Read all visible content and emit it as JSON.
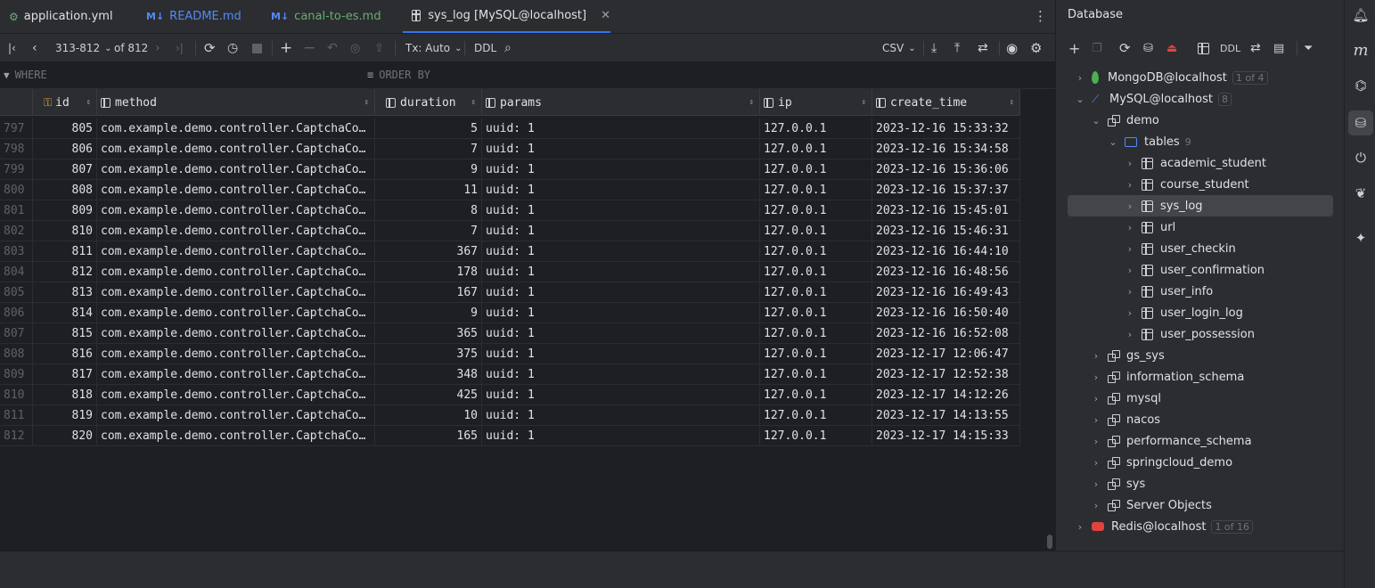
{
  "tabs": [
    {
      "label": "application.yml",
      "icon": "yaml-file-icon"
    },
    {
      "label": "README.md",
      "prefix": "M↓",
      "icon": "markdown-file-icon"
    },
    {
      "label": "canal-to-es.md",
      "prefix": "M↓",
      "icon": "markdown-file-icon"
    },
    {
      "label": "sys_log [MySQL@localhost]",
      "icon": "table-icon",
      "active": true
    }
  ],
  "toolbar": {
    "range": "313-812",
    "of_total": "of 812",
    "tx_mode": "Tx: Auto",
    "ddl": "DDL",
    "export_format": "CSV"
  },
  "filter": {
    "where": "WHERE",
    "order_by": "ORDER BY"
  },
  "table": {
    "columns": [
      "id",
      "method",
      "duration",
      "params",
      "ip",
      "create_time"
    ],
    "rows": [
      {
        "n": "797",
        "id": "805",
        "method": "com.example.demo.controller.CaptchaCo…",
        "duration": "5",
        "params": "uuid: 1",
        "ip": "127.0.0.1",
        "create_time": "2023-12-16 15:33:32"
      },
      {
        "n": "798",
        "id": "806",
        "method": "com.example.demo.controller.CaptchaCo…",
        "duration": "7",
        "params": "uuid: 1",
        "ip": "127.0.0.1",
        "create_time": "2023-12-16 15:34:58"
      },
      {
        "n": "799",
        "id": "807",
        "method": "com.example.demo.controller.CaptchaCo…",
        "duration": "9",
        "params": "uuid: 1",
        "ip": "127.0.0.1",
        "create_time": "2023-12-16 15:36:06"
      },
      {
        "n": "800",
        "id": "808",
        "method": "com.example.demo.controller.CaptchaCo…",
        "duration": "11",
        "params": "uuid: 1",
        "ip": "127.0.0.1",
        "create_time": "2023-12-16 15:37:37"
      },
      {
        "n": "801",
        "id": "809",
        "method": "com.example.demo.controller.CaptchaCo…",
        "duration": "8",
        "params": "uuid: 1",
        "ip": "127.0.0.1",
        "create_time": "2023-12-16 15:45:01"
      },
      {
        "n": "802",
        "id": "810",
        "method": "com.example.demo.controller.CaptchaCo…",
        "duration": "7",
        "params": "uuid: 1",
        "ip": "127.0.0.1",
        "create_time": "2023-12-16 15:46:31"
      },
      {
        "n": "803",
        "id": "811",
        "method": "com.example.demo.controller.CaptchaCo…",
        "duration": "367",
        "params": "uuid: 1",
        "ip": "127.0.0.1",
        "create_time": "2023-12-16 16:44:10"
      },
      {
        "n": "804",
        "id": "812",
        "method": "com.example.demo.controller.CaptchaCo…",
        "duration": "178",
        "params": "uuid: 1",
        "ip": "127.0.0.1",
        "create_time": "2023-12-16 16:48:56"
      },
      {
        "n": "805",
        "id": "813",
        "method": "com.example.demo.controller.CaptchaCo…",
        "duration": "167",
        "params": "uuid: 1",
        "ip": "127.0.0.1",
        "create_time": "2023-12-16 16:49:43"
      },
      {
        "n": "806",
        "id": "814",
        "method": "com.example.demo.controller.CaptchaCo…",
        "duration": "9",
        "params": "uuid: 1",
        "ip": "127.0.0.1",
        "create_time": "2023-12-16 16:50:40"
      },
      {
        "n": "807",
        "id": "815",
        "method": "com.example.demo.controller.CaptchaCo…",
        "duration": "365",
        "params": "uuid: 1",
        "ip": "127.0.0.1",
        "create_time": "2023-12-16 16:52:08"
      },
      {
        "n": "808",
        "id": "816",
        "method": "com.example.demo.controller.CaptchaCo…",
        "duration": "375",
        "params": "uuid: 1",
        "ip": "127.0.0.1",
        "create_time": "2023-12-17 12:06:47"
      },
      {
        "n": "809",
        "id": "817",
        "method": "com.example.demo.controller.CaptchaCo…",
        "duration": "348",
        "params": "uuid: 1",
        "ip": "127.0.0.1",
        "create_time": "2023-12-17 12:52:38"
      },
      {
        "n": "810",
        "id": "818",
        "method": "com.example.demo.controller.CaptchaCo…",
        "duration": "425",
        "params": "uuid: 1",
        "ip": "127.0.0.1",
        "create_time": "2023-12-17 14:12:26"
      },
      {
        "n": "811",
        "id": "819",
        "method": "com.example.demo.controller.CaptchaCo…",
        "duration": "10",
        "params": "uuid: 1",
        "ip": "127.0.0.1",
        "create_time": "2023-12-17 14:13:55"
      },
      {
        "n": "812",
        "id": "820",
        "method": "com.example.demo.controller.CaptchaCo…",
        "duration": "165",
        "params": "uuid: 1",
        "ip": "127.0.0.1",
        "create_time": "2023-12-17 14:15:33"
      }
    ]
  },
  "database": {
    "title": "Database",
    "toolbar_ddl": "DDL",
    "tree": [
      {
        "label": "MongoDB@localhost",
        "badge": "1 of 4",
        "kind": "mongo",
        "level": 0,
        "chev": "›"
      },
      {
        "label": "MySQL@localhost",
        "badge": "8",
        "kind": "mysql",
        "level": 0,
        "chev": "⌄"
      },
      {
        "label": "demo",
        "kind": "schema",
        "level": 1,
        "chev": "⌄"
      },
      {
        "label": "tables",
        "count": "9",
        "kind": "folder",
        "level": 2,
        "chev": "⌄"
      },
      {
        "label": "academic_student",
        "kind": "table",
        "level": 3,
        "chev": "›"
      },
      {
        "label": "course_student",
        "kind": "table",
        "level": 3,
        "chev": "›"
      },
      {
        "label": "sys_log",
        "kind": "table",
        "level": 3,
        "chev": "›",
        "selected": true
      },
      {
        "label": "url",
        "kind": "table",
        "level": 3,
        "chev": "›"
      },
      {
        "label": "user_checkin",
        "kind": "table",
        "level": 3,
        "chev": "›"
      },
      {
        "label": "user_confirmation",
        "kind": "table",
        "level": 3,
        "chev": "›"
      },
      {
        "label": "user_info",
        "kind": "table",
        "level": 3,
        "chev": "›"
      },
      {
        "label": "user_login_log",
        "kind": "table",
        "level": 3,
        "chev": "›"
      },
      {
        "label": "user_possession",
        "kind": "table",
        "level": 3,
        "chev": "›"
      },
      {
        "label": "gs_sys",
        "kind": "schema",
        "level": 1,
        "chev": "›"
      },
      {
        "label": "information_schema",
        "kind": "schema",
        "level": 1,
        "chev": "›"
      },
      {
        "label": "mysql",
        "kind": "schema",
        "level": 1,
        "chev": "›"
      },
      {
        "label": "nacos",
        "kind": "schema",
        "level": 1,
        "chev": "›"
      },
      {
        "label": "performance_schema",
        "kind": "schema",
        "level": 1,
        "chev": "›"
      },
      {
        "label": "springcloud_demo",
        "kind": "schema",
        "level": 1,
        "chev": "›"
      },
      {
        "label": "sys",
        "kind": "schema",
        "level": 1,
        "chev": "›"
      },
      {
        "label": "Server Objects",
        "kind": "server",
        "level": 1,
        "chev": "›"
      },
      {
        "label": "Redis@localhost",
        "badge": "1 of 16",
        "kind": "redis",
        "level": 0,
        "chev": "›"
      }
    ]
  },
  "colors": {
    "accent": "#3574f0",
    "selection": "#43454a",
    "mongo_green": "#4caf50",
    "redis_red": "#e0443e"
  }
}
